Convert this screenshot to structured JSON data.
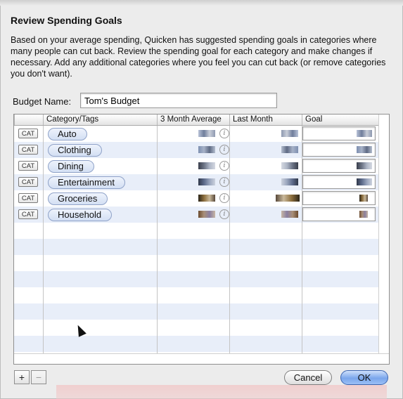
{
  "dialog": {
    "title": "Review Spending Goals",
    "description": "Based on your average spending, Quicken has suggested spending goals in categories where many people can cut back.  Review the spending goal for each category and make changes if necessary.  Add any additional categories where you feel you can cut back (or remove categories you don't want).",
    "budget_name_label": "Budget Name:",
    "budget_name_value": "Tom's Budget"
  },
  "table": {
    "columns": [
      "Category/Tags",
      "3 Month Average",
      "Last Month",
      "Goal"
    ],
    "cat_label": "CAT",
    "info_glyph": "i",
    "rows": [
      {
        "category": "Auto"
      },
      {
        "category": "Clothing"
      },
      {
        "category": "Dining"
      },
      {
        "category": "Entertainment"
      },
      {
        "category": "Groceries"
      },
      {
        "category": "Household"
      }
    ]
  },
  "footer": {
    "add_label": "+",
    "remove_label": "−",
    "cancel_label": "Cancel",
    "ok_label": "OK"
  },
  "colors": {
    "ok_button": "#7aa6ec",
    "row_alt": "#e8eef9",
    "token": "#d3dff3"
  }
}
